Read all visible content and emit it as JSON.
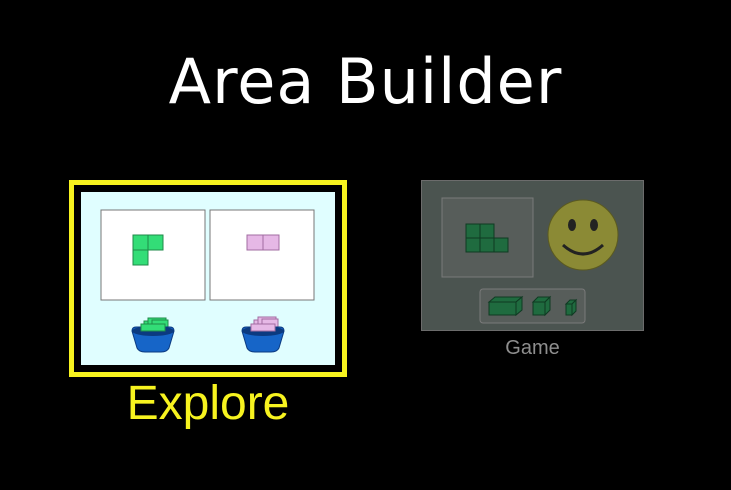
{
  "app": {
    "title": "Area Builder"
  },
  "screens": {
    "explore": {
      "label": "Explore",
      "selected": true,
      "highlight_color": "#f7f31f"
    },
    "game": {
      "label": "Game",
      "selected": false
    }
  },
  "icons": {
    "explore": [
      "green-l-shape-icon",
      "pink-rectangle-icon",
      "green-bucket-icon",
      "pink-bucket-icon"
    ],
    "game": [
      "green-shape-icon",
      "smiley-face-icon",
      "shape-toolbox-icon"
    ]
  },
  "colors": {
    "background": "#000000",
    "title": "#ffffff",
    "explore_highlight": "#f7f31f",
    "explore_panel": "#e0feff",
    "green_shape": "#33dd77",
    "pink_shape": "#e6b8e6",
    "bucket_blue": "#1665c8",
    "game_label": "#8e8e8e"
  }
}
